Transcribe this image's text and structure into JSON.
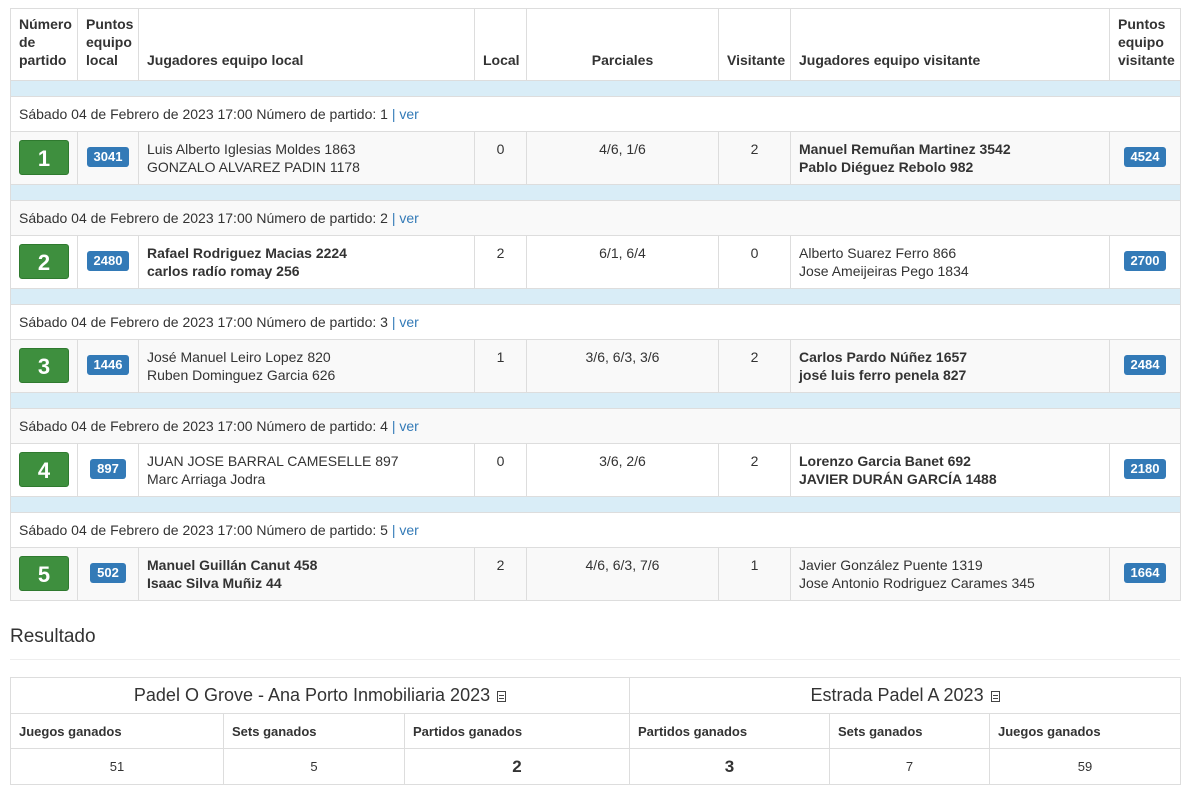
{
  "headers": {
    "match_number": [
      "Número",
      "de",
      "partido"
    ],
    "home_points": [
      "Puntos",
      "equipo",
      "local"
    ],
    "home_players": "Jugadores equipo local",
    "home": "Local",
    "partials": "Parciales",
    "away": "Visitante",
    "away_players": "Jugadores equipo visitante",
    "away_points": [
      "Puntos",
      "equipo",
      "visitante"
    ]
  },
  "link_label": "ver",
  "matches": [
    {
      "info": "Sábado 04 de Febrero de 2023 17:00 Número de partido: 1",
      "number": "1",
      "home_points": "3041",
      "home_players": [
        "Luis Alberto Iglesias Moldes 1863",
        "GONZALO ALVAREZ PADIN 1178"
      ],
      "home_winner": false,
      "home_score": "0",
      "partials": "4/6, 1/6",
      "away_score": "2",
      "away_players": [
        "Manuel Remuñan Martinez 3542",
        "Pablo Diéguez Rebolo 982"
      ],
      "away_winner": true,
      "away_points": "4524"
    },
    {
      "info": "Sábado 04 de Febrero de 2023 17:00 Número de partido: 2",
      "number": "2",
      "home_points": "2480",
      "home_players": [
        "Rafael Rodriguez Macias 2224",
        "carlos radío romay 256"
      ],
      "home_winner": true,
      "home_score": "2",
      "partials": "6/1, 6/4",
      "away_score": "0",
      "away_players": [
        "Alberto Suarez Ferro 866",
        "Jose Ameijeiras Pego 1834"
      ],
      "away_winner": false,
      "away_points": "2700"
    },
    {
      "info": "Sábado 04 de Febrero de 2023 17:00 Número de partido: 3",
      "number": "3",
      "home_points": "1446",
      "home_players": [
        "José Manuel Leiro Lopez 820",
        "Ruben Dominguez Garcia 626"
      ],
      "home_winner": false,
      "home_score": "1",
      "partials": "3/6, 6/3, 3/6",
      "away_score": "2",
      "away_players": [
        "Carlos Pardo Núñez 1657",
        "josé luis ferro penela 827"
      ],
      "away_winner": true,
      "away_points": "2484"
    },
    {
      "info": "Sábado 04 de Febrero de 2023 17:00 Número de partido: 4",
      "number": "4",
      "home_points": "897",
      "home_players": [
        "JUAN JOSE BARRAL CAMESELLE 897",
        "Marc Arriaga Jodra"
      ],
      "home_winner": false,
      "home_score": "0",
      "partials": "3/6, 2/6",
      "away_score": "2",
      "away_players": [
        "Lorenzo Garcia Banet 692",
        "JAVIER DURÁN GARCÍA 1488"
      ],
      "away_winner": true,
      "away_points": "2180"
    },
    {
      "info": "Sábado 04 de Febrero de 2023 17:00 Número de partido: 5",
      "number": "5",
      "home_points": "502",
      "home_players": [
        "Manuel Guillán Canut 458",
        "Isaac Silva Muñiz 44"
      ],
      "home_winner": true,
      "home_score": "2",
      "partials": "4/6, 6/3, 7/6",
      "away_score": "1",
      "away_players": [
        "Javier González Puente 1319",
        "Jose Antonio Rodriguez Carames 345"
      ],
      "away_winner": false,
      "away_points": "1664"
    }
  ],
  "result": {
    "title": "Resultado",
    "home_team": "Padel O Grove - Ana Porto Inmobiliaria 2023",
    "away_team": "Estrada Padel A 2023",
    "home_labels": [
      "Juegos ganados",
      "Sets ganados",
      "Partidos ganados"
    ],
    "away_labels": [
      "Partidos ganados",
      "Sets ganados",
      "Juegos ganados"
    ],
    "home_values": [
      "51",
      "5",
      "2"
    ],
    "away_values": [
      "3",
      "7",
      "59"
    ]
  },
  "colors": {
    "match_number_bg": "#3e8f3e",
    "badge_bg": "#337ab7",
    "spacer_bg": "#d9edf7",
    "link": "#337ab7"
  },
  "icons": {
    "team_detail": "list-document-icon"
  }
}
